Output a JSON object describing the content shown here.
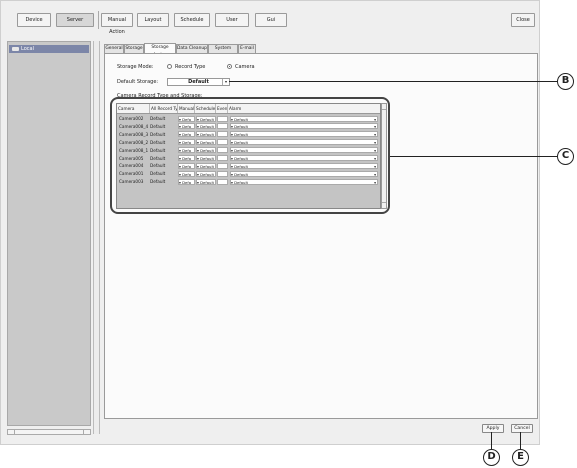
{
  "toolbar": {
    "buttons": [
      "Device",
      "Server",
      "Manual Action",
      "Layout",
      "Schedule",
      "User",
      "Gui"
    ],
    "close": "Close"
  },
  "sidebar": {
    "item": "Local",
    "icon": "server-icon"
  },
  "tabs": [
    "General",
    "Storage",
    "Storage Assign",
    "Data Cleanup",
    "System Alert",
    "E-mail"
  ],
  "active_tab": "Storage Assign",
  "storage": {
    "mode_label": "Storage Mode:",
    "mode_options": [
      "Record Type",
      "Camera"
    ],
    "mode_selected": "Camera",
    "default_label": "Default Storage:",
    "default_value": "Default",
    "section_label": "Camera Record Type and Storage:"
  },
  "table": {
    "headers": [
      "Camera",
      "All Record Type",
      "Manual",
      "Schedule",
      "Event",
      "Alarm"
    ],
    "rows": [
      {
        "camera": "Camera002",
        "all": "Default",
        "manual": "Defa",
        "schedule": "Default",
        "event": "",
        "alarm": "Default"
      },
      {
        "camera": "Camera008_4",
        "all": "Default",
        "manual": "Defa",
        "schedule": "Default",
        "event": "",
        "alarm": "Default"
      },
      {
        "camera": "Camera008_3",
        "all": "Default",
        "manual": "Defa",
        "schedule": "Default",
        "event": "",
        "alarm": "Default"
      },
      {
        "camera": "Camera008_2",
        "all": "Default",
        "manual": "Defa",
        "schedule": "Default",
        "event": "",
        "alarm": "Default"
      },
      {
        "camera": "Camera008_1",
        "all": "Default",
        "manual": "Defa",
        "schedule": "Default",
        "event": "",
        "alarm": "Default"
      },
      {
        "camera": "Camera005",
        "all": "Default",
        "manual": "Defa",
        "schedule": "Default",
        "event": "",
        "alarm": "Default"
      },
      {
        "camera": "Camera004",
        "all": "Default",
        "manual": "Defa",
        "schedule": "Default",
        "event": "",
        "alarm": "Default"
      },
      {
        "camera": "Camera001",
        "all": "Default",
        "manual": "Defa",
        "schedule": "Default",
        "event": "",
        "alarm": "Default"
      },
      {
        "camera": "Camera003",
        "all": "Default",
        "manual": "Defa",
        "schedule": "Default",
        "event": "",
        "alarm": "Default"
      }
    ]
  },
  "footer": {
    "apply": "Apply",
    "cancel": "Cancel"
  },
  "callouts": {
    "b": "B",
    "c": "C",
    "d": "D",
    "e": "E"
  }
}
